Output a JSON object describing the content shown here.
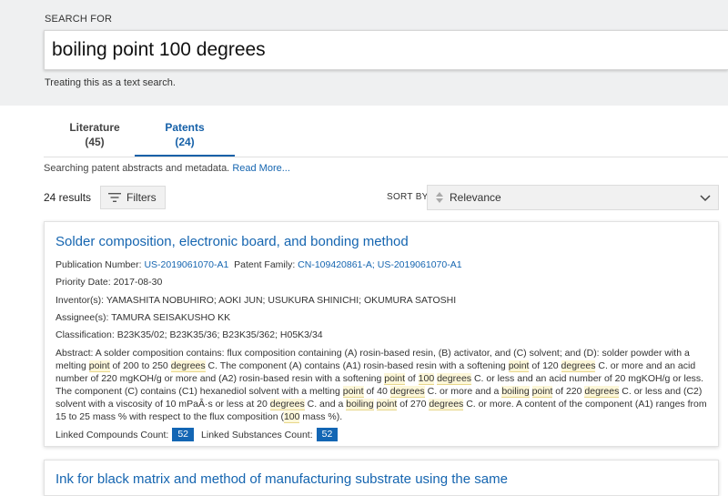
{
  "search": {
    "label": "SEARCH FOR",
    "query": "boiling point 100 degrees",
    "note": "Treating this as a text search."
  },
  "tabs": [
    {
      "name": "Literature",
      "count": "(45)",
      "active": false
    },
    {
      "name": "Patents",
      "count": "(24)",
      "active": true
    }
  ],
  "source_note": {
    "text": "Searching patent abstracts and metadata.",
    "link": "Read More..."
  },
  "toolbar": {
    "results_count": "24 results",
    "filters_label": "Filters",
    "sort_label": "SORT BY",
    "sort_value": "Relevance"
  },
  "results": [
    {
      "title": "Solder composition, electronic board, and bonding method",
      "publication_label": "Publication Number:",
      "publication_number": "US-2019061070-A1",
      "family_label": "Patent Family:",
      "family_1": "CN-109420861-A;",
      "family_2": "US-2019061070-A1",
      "priority_date": "Priority Date: 2017-08-30",
      "inventors": "Inventor(s): YAMASHITA NOBUHIRO; AOKI JUN; USUKURA SHINICHI; OKUMURA SATOSHI",
      "assignees": "Assignee(s): TAMURA SEISAKUSHO KK",
      "classification": "Classification: B23K35/02; B23K35/36; B23K35/362; H05K3/34",
      "abstract_segments": [
        {
          "text": "Abstract: A solder composition contains: flux composition containing (A) rosin-based resin, (B) activator, and (C) solvent; and (D): solder powder with a melting ",
          "hl": false
        },
        {
          "text": "point",
          "hl": true
        },
        {
          "text": " of 200 to 250 ",
          "hl": false
        },
        {
          "text": "degrees",
          "hl": true
        },
        {
          "text": " C. The component (A) contains (A1) rosin-based resin with a softening ",
          "hl": false
        },
        {
          "text": "point",
          "hl": true
        },
        {
          "text": " of 120 ",
          "hl": false
        },
        {
          "text": "degrees",
          "hl": true
        },
        {
          "text": " C. or more and an acid number of 220 mgKOH/g or more and (A2) rosin-based resin with a softening ",
          "hl": false
        },
        {
          "text": "point",
          "hl": true
        },
        {
          "text": " of ",
          "hl": false
        },
        {
          "text": "100",
          "hl": true
        },
        {
          "text": " ",
          "hl": false
        },
        {
          "text": "degrees",
          "hl": true
        },
        {
          "text": " C. or less and an acid number of 20 mgKOH/g or less. The component (C) contains (C1) hexanediol solvent with a melting ",
          "hl": false
        },
        {
          "text": "point",
          "hl": true
        },
        {
          "text": " of 40 ",
          "hl": false
        },
        {
          "text": "degrees",
          "hl": true
        },
        {
          "text": " C. or more and a ",
          "hl": false
        },
        {
          "text": "boiling",
          "hl": true
        },
        {
          "text": " ",
          "hl": false
        },
        {
          "text": "point",
          "hl": true
        },
        {
          "text": " of 220 ",
          "hl": false
        },
        {
          "text": "degrees",
          "hl": true
        },
        {
          "text": " C. or less and (C2) solvent with a viscosity of 10 mPaÂ·s or less at 20 ",
          "hl": false
        },
        {
          "text": "degrees",
          "hl": true
        },
        {
          "text": " C. and a ",
          "hl": false
        },
        {
          "text": "boiling",
          "hl": true
        },
        {
          "text": " ",
          "hl": false
        },
        {
          "text": "point",
          "hl": true
        },
        {
          "text": " of 270 ",
          "hl": false
        },
        {
          "text": "degrees",
          "hl": true
        },
        {
          "text": " C. or more. A content of the component (A1) ranges from 15 to 25 mass % with respect to the flux composition (",
          "hl": false
        },
        {
          "text": "100",
          "hl": true
        },
        {
          "text": " mass %).",
          "hl": false
        }
      ],
      "linked_compounds_label": "Linked Compounds Count:",
      "linked_compounds": "52",
      "linked_substances_label": "Linked Substances Count:",
      "linked_substances": "52"
    },
    {
      "title": "Ink for black matrix and method of manufacturing substrate using the same"
    }
  ],
  "colors": {
    "link": "#1565b0",
    "tab_active": "#1560a8",
    "badge": "#1366b4",
    "search_band": "#eff0f1",
    "highlight": "#fdf7d9"
  },
  "icons": [
    "filter-icon",
    "sort-updown-icon",
    "chevron-down-icon"
  ]
}
